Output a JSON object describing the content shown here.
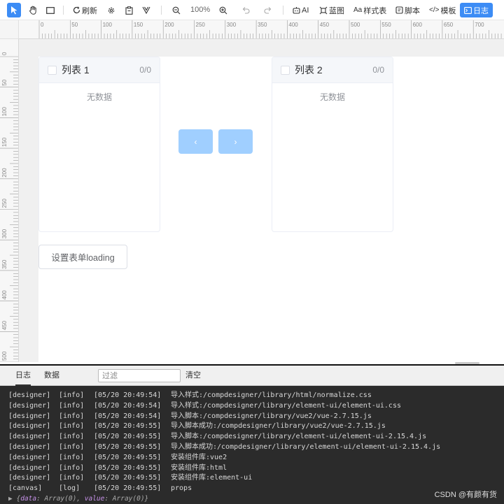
{
  "toolbar": {
    "refresh_label": "刷新",
    "zoom_value": "100%",
    "ai_label": "AI",
    "blueprint_label": "蓝图",
    "styles_label": "样式表",
    "script_label": "脚本",
    "template_label": "模板",
    "log_label": "日志"
  },
  "ruler": {
    "top_ticks": [
      "0",
      "50",
      "100",
      "150",
      "200",
      "250",
      "300",
      "350",
      "400",
      "450",
      "500",
      "550",
      "600",
      "650",
      "700"
    ],
    "left_ticks": [
      "0",
      "50",
      "100",
      "150",
      "200",
      "250",
      "300",
      "350",
      "400",
      "450",
      "500"
    ]
  },
  "transfer": {
    "left": {
      "title": "列表 1",
      "count": "0/0",
      "empty": "无数据"
    },
    "right": {
      "title": "列表 2",
      "count": "0/0",
      "empty": "无数据"
    },
    "btn_left": "‹",
    "btn_right": "›"
  },
  "loading_button": "设置表单loading",
  "log_panel": {
    "tabs": [
      "日志",
      "数据"
    ],
    "filter_placeholder": "过滤",
    "clear_label": "清空",
    "lines": [
      {
        "src": "[designer]",
        "lvl": "[info]",
        "time": "[05/20 20:49:54]",
        "msg": "导入样式:/compdesigner/library/html/normalize.css"
      },
      {
        "src": "[designer]",
        "lvl": "[info]",
        "time": "[05/20 20:49:54]",
        "msg": "导入样式:/compdesigner/library/element-ui/element-ui.css"
      },
      {
        "src": "[designer]",
        "lvl": "[info]",
        "time": "[05/20 20:49:54]",
        "msg": "导入脚本:/compdesigner/library/vue2/vue-2.7.15.js"
      },
      {
        "src": "[designer]",
        "lvl": "[info]",
        "time": "[05/20 20:49:55]",
        "msg": "导入脚本成功:/compdesigner/library/vue2/vue-2.7.15.js"
      },
      {
        "src": "[designer]",
        "lvl": "[info]",
        "time": "[05/20 20:49:55]",
        "msg": "导入脚本:/compdesigner/library/element-ui/element-ui-2.15.4.js"
      },
      {
        "src": "[designer]",
        "lvl": "[info]",
        "time": "[05/20 20:49:55]",
        "msg": "导入脚本成功:/compdesigner/library/element-ui/element-ui-2.15.4.js"
      },
      {
        "src": "[designer]",
        "lvl": "[info]",
        "time": "[05/20 20:49:55]",
        "msg": "安装组件库:vue2"
      },
      {
        "src": "[designer]",
        "lvl": "[info]",
        "time": "[05/20 20:49:55]",
        "msg": "安装组件库:html"
      },
      {
        "src": "[designer]",
        "lvl": "[info]",
        "time": "[05/20 20:49:55]",
        "msg": "安装组件库:element-ui"
      },
      {
        "src": "[canvas]",
        "lvl": "[log]",
        "time": "[05/20 20:49:55]",
        "msg": "props"
      }
    ],
    "object_line": {
      "arrow": "▶",
      "open": "{",
      "k1": "data",
      "v1": ": Array(0), ",
      "k2": "value",
      "v2": ": Array(0)",
      "close": "}"
    }
  },
  "watermark": "CSDN @有颜有货"
}
